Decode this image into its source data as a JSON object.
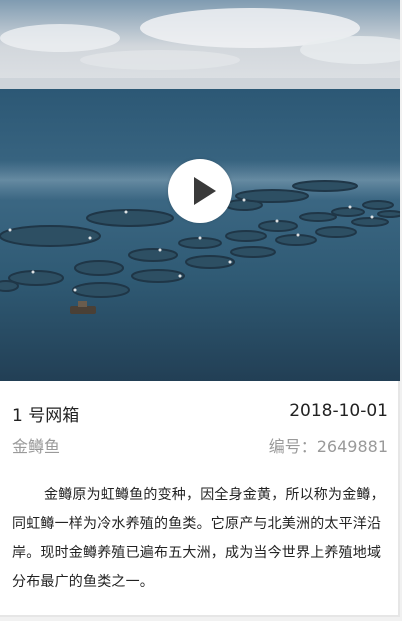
{
  "card": {
    "title": "1 号网箱",
    "date": "2018-10-01",
    "species": "金鳟鱼",
    "code_label": "编号：",
    "code_value": "2649881",
    "description": "金鳟原为虹鳟鱼的变种，因全身金黄，所以称为金鳟，同虹鳟一样为冷水养殖的鱼类。它原产与北美洲的太平洋沿岸。现时金鳟养殖已遍布五大洲，成为当今世界上养殖地域分布最广的鱼类之一。"
  },
  "media": {
    "play_icon": "play-icon",
    "colors": {
      "sky": "#d9dde2",
      "sea": "#2f5670",
      "play_bg": "#ffffff"
    }
  }
}
